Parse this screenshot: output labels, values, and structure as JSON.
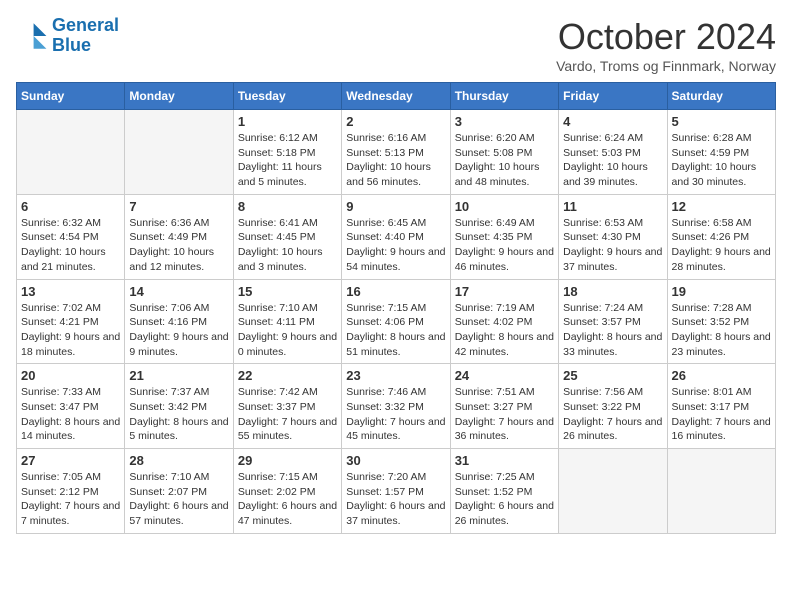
{
  "header": {
    "logo_line1": "General",
    "logo_line2": "Blue",
    "month": "October 2024",
    "location": "Vardo, Troms og Finnmark, Norway"
  },
  "weekdays": [
    "Sunday",
    "Monday",
    "Tuesday",
    "Wednesday",
    "Thursday",
    "Friday",
    "Saturday"
  ],
  "weeks": [
    [
      {
        "day": "",
        "info": ""
      },
      {
        "day": "",
        "info": ""
      },
      {
        "day": "1",
        "info": "Sunrise: 6:12 AM\nSunset: 5:18 PM\nDaylight: 11 hours\nand 5 minutes."
      },
      {
        "day": "2",
        "info": "Sunrise: 6:16 AM\nSunset: 5:13 PM\nDaylight: 10 hours\nand 56 minutes."
      },
      {
        "day": "3",
        "info": "Sunrise: 6:20 AM\nSunset: 5:08 PM\nDaylight: 10 hours\nand 48 minutes."
      },
      {
        "day": "4",
        "info": "Sunrise: 6:24 AM\nSunset: 5:03 PM\nDaylight: 10 hours\nand 39 minutes."
      },
      {
        "day": "5",
        "info": "Sunrise: 6:28 AM\nSunset: 4:59 PM\nDaylight: 10 hours\nand 30 minutes."
      }
    ],
    [
      {
        "day": "6",
        "info": "Sunrise: 6:32 AM\nSunset: 4:54 PM\nDaylight: 10 hours\nand 21 minutes."
      },
      {
        "day": "7",
        "info": "Sunrise: 6:36 AM\nSunset: 4:49 PM\nDaylight: 10 hours\nand 12 minutes."
      },
      {
        "day": "8",
        "info": "Sunrise: 6:41 AM\nSunset: 4:45 PM\nDaylight: 10 hours\nand 3 minutes."
      },
      {
        "day": "9",
        "info": "Sunrise: 6:45 AM\nSunset: 4:40 PM\nDaylight: 9 hours\nand 54 minutes."
      },
      {
        "day": "10",
        "info": "Sunrise: 6:49 AM\nSunset: 4:35 PM\nDaylight: 9 hours\nand 46 minutes."
      },
      {
        "day": "11",
        "info": "Sunrise: 6:53 AM\nSunset: 4:30 PM\nDaylight: 9 hours\nand 37 minutes."
      },
      {
        "day": "12",
        "info": "Sunrise: 6:58 AM\nSunset: 4:26 PM\nDaylight: 9 hours\nand 28 minutes."
      }
    ],
    [
      {
        "day": "13",
        "info": "Sunrise: 7:02 AM\nSunset: 4:21 PM\nDaylight: 9 hours\nand 18 minutes."
      },
      {
        "day": "14",
        "info": "Sunrise: 7:06 AM\nSunset: 4:16 PM\nDaylight: 9 hours\nand 9 minutes."
      },
      {
        "day": "15",
        "info": "Sunrise: 7:10 AM\nSunset: 4:11 PM\nDaylight: 9 hours\nand 0 minutes."
      },
      {
        "day": "16",
        "info": "Sunrise: 7:15 AM\nSunset: 4:06 PM\nDaylight: 8 hours\nand 51 minutes."
      },
      {
        "day": "17",
        "info": "Sunrise: 7:19 AM\nSunset: 4:02 PM\nDaylight: 8 hours\nand 42 minutes."
      },
      {
        "day": "18",
        "info": "Sunrise: 7:24 AM\nSunset: 3:57 PM\nDaylight: 8 hours\nand 33 minutes."
      },
      {
        "day": "19",
        "info": "Sunrise: 7:28 AM\nSunset: 3:52 PM\nDaylight: 8 hours\nand 23 minutes."
      }
    ],
    [
      {
        "day": "20",
        "info": "Sunrise: 7:33 AM\nSunset: 3:47 PM\nDaylight: 8 hours\nand 14 minutes."
      },
      {
        "day": "21",
        "info": "Sunrise: 7:37 AM\nSunset: 3:42 PM\nDaylight: 8 hours\nand 5 minutes."
      },
      {
        "day": "22",
        "info": "Sunrise: 7:42 AM\nSunset: 3:37 PM\nDaylight: 7 hours\nand 55 minutes."
      },
      {
        "day": "23",
        "info": "Sunrise: 7:46 AM\nSunset: 3:32 PM\nDaylight: 7 hours\nand 45 minutes."
      },
      {
        "day": "24",
        "info": "Sunrise: 7:51 AM\nSunset: 3:27 PM\nDaylight: 7 hours\nand 36 minutes."
      },
      {
        "day": "25",
        "info": "Sunrise: 7:56 AM\nSunset: 3:22 PM\nDaylight: 7 hours\nand 26 minutes."
      },
      {
        "day": "26",
        "info": "Sunrise: 8:01 AM\nSunset: 3:17 PM\nDaylight: 7 hours\nand 16 minutes."
      }
    ],
    [
      {
        "day": "27",
        "info": "Sunrise: 7:05 AM\nSunset: 2:12 PM\nDaylight: 7 hours\nand 7 minutes."
      },
      {
        "day": "28",
        "info": "Sunrise: 7:10 AM\nSunset: 2:07 PM\nDaylight: 6 hours\nand 57 minutes."
      },
      {
        "day": "29",
        "info": "Sunrise: 7:15 AM\nSunset: 2:02 PM\nDaylight: 6 hours\nand 47 minutes."
      },
      {
        "day": "30",
        "info": "Sunrise: 7:20 AM\nSunset: 1:57 PM\nDaylight: 6 hours\nand 37 minutes."
      },
      {
        "day": "31",
        "info": "Sunrise: 7:25 AM\nSunset: 1:52 PM\nDaylight: 6 hours\nand 26 minutes."
      },
      {
        "day": "",
        "info": ""
      },
      {
        "day": "",
        "info": ""
      }
    ]
  ]
}
